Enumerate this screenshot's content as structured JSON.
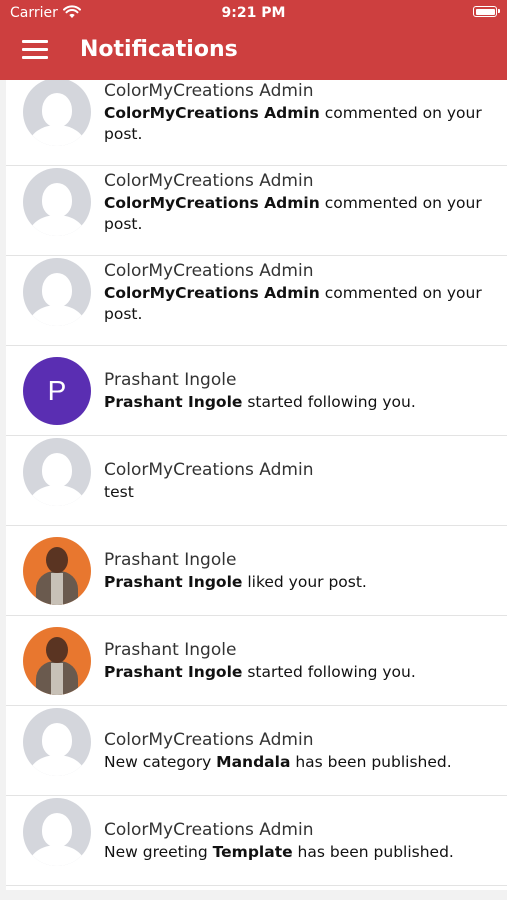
{
  "status_bar": {
    "carrier": "Carrier",
    "time": "9:21 PM"
  },
  "header": {
    "title": "Notifications"
  },
  "notifications": [
    {
      "name": "ColorMyCreations Admin",
      "bold": "ColorMyCreations Admin",
      "rest": " commented on your post.",
      "avatar": "placeholder"
    },
    {
      "name": "ColorMyCreations Admin",
      "bold": "ColorMyCreations Admin",
      "rest": " commented on your post.",
      "avatar": "placeholder"
    },
    {
      "name": "ColorMyCreations Admin",
      "bold": "ColorMyCreations Admin",
      "rest": " commented on your post.",
      "avatar": "placeholder"
    },
    {
      "name": "Prashant Ingole",
      "bold": "Prashant Ingole",
      "rest": " started following you.",
      "avatar": "letter",
      "letter": "P"
    },
    {
      "name": "ColorMyCreations Admin",
      "pre": "test",
      "avatar": "placeholder"
    },
    {
      "name": "Prashant Ingole",
      "bold": "Prashant Ingole",
      "rest": " liked your post.",
      "avatar": "photo"
    },
    {
      "name": "Prashant Ingole",
      "bold": "Prashant Ingole",
      "rest": " started following you.",
      "avatar": "photo"
    },
    {
      "name": "ColorMyCreations Admin",
      "pre": "New category ",
      "bold": "Mandala",
      "rest": " has been published.",
      "avatar": "placeholder"
    },
    {
      "name": "ColorMyCreations Admin",
      "pre": "New greeting ",
      "bold": "Template",
      "rest": " has been published.",
      "avatar": "placeholder"
    }
  ],
  "colors": {
    "header": "#cd3f3f",
    "letter_avatar": "#5a2eb2",
    "photo_avatar_bg": "#e8772f"
  }
}
